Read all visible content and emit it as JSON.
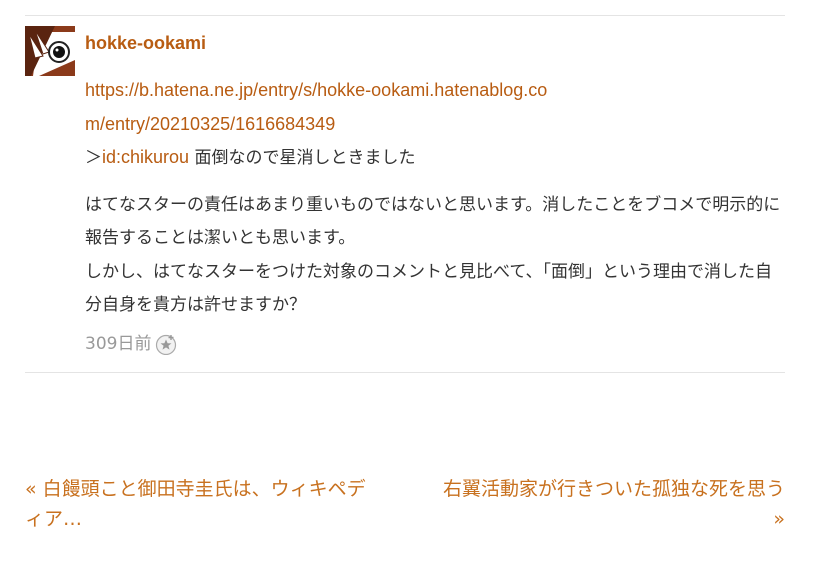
{
  "comment": {
    "author": "hokke-ookami",
    "url_text": "https://b.hatena.ne.jp/entry/s/hokke-ookami.hatenablog.com/entry/20210325/1616684349",
    "reply_prefix": "＞",
    "reply_id": "id:chikurou",
    "reply_text": " 面倒なので星消しときました",
    "paragraph_1": "はてなスターの責任はあまり重いものではないと思います。消したことをブコメで明示的に報告することは潔いとも思います。",
    "paragraph_2": "しかし、はてなスターをつけた対象のコメントと見比べて、「面倒」という理由で消した自分自身を貴方は許せますか？",
    "timestamp": "309日前",
    "add_star_icon": "add-star-icon"
  },
  "pager": {
    "prev_label": "« 白饅頭こと御田寺圭氏は、ウィキペディア…",
    "next_label": "右翼活動家が行きついた孤独な死を思う »"
  },
  "colors": {
    "link": "#b85c12",
    "pager_link": "#c8711f",
    "muted": "#999999",
    "rule": "#e4e4e4"
  }
}
